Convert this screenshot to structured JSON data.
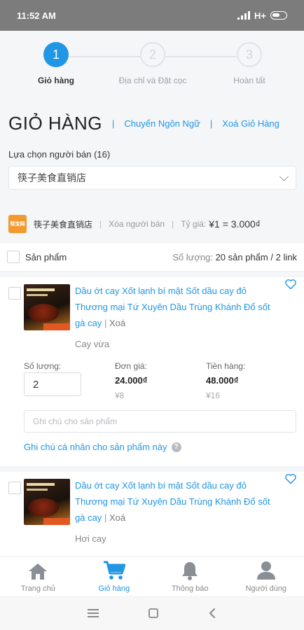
{
  "status": {
    "time": "11:52 AM",
    "network": "H+"
  },
  "stepper": {
    "steps": [
      {
        "num": "1",
        "label": "Giỏ hàng"
      },
      {
        "num": "2",
        "label": "Địa chỉ và Đặt cọc"
      },
      {
        "num": "3",
        "label": "Hoàn tất"
      }
    ]
  },
  "header": {
    "title": "GIỎ HÀNG",
    "change_lang": "Chuyển Ngôn Ngữ",
    "clear_cart": "Xoá Giỏ Hàng"
  },
  "seller_filter": {
    "label": "Lựa chọn người bán (16)",
    "selected": "筷子美食直销店"
  },
  "shop": {
    "logo_text": "筷宝网",
    "name": "筷子美食直销店",
    "remove": "Xóa người bán",
    "rate_label": "Tỷ giá:",
    "rate_value": "¥1 = 3.000₫"
  },
  "list_header": {
    "product": "Sản phẩm",
    "qty_label": "Số lượng:",
    "qty_value": "20 sản phẩm",
    "slash": "/",
    "links_value": "2",
    "links_label": "link"
  },
  "items": [
    {
      "name": "Dầu ớt cay Xốt lạnh bí mật Sốt dầu cay đỏ Thương mại Tứ Xuyên Dầu Trùng Khánh Đổ sốt gà cay",
      "delete": "Xoá",
      "variant": "Cay vừa",
      "qty_label": "Số lượng:",
      "qty": "2",
      "unit_label": "Đơn giá:",
      "unit_price": "24.000₫",
      "unit_price_cny": "¥8",
      "total_label": "Tiền hàng:",
      "total": "48.000₫",
      "total_cny": "¥16",
      "note_placeholder": "Ghi chú cho sản phẩm",
      "personal_note": "Ghi chú cá nhân cho sản phẩm này"
    },
    {
      "name": "Dầu ớt cay Xốt lạnh bí mật Sốt dầu cay đỏ Thương mại Tứ Xuyên Dầu Trùng Khánh Đổ sốt gà cay",
      "delete": "Xoá",
      "variant": "Hơi cay"
    }
  ],
  "nav": [
    {
      "label": "Trang chủ",
      "icon": "home-icon"
    },
    {
      "label": "Giỏ hàng",
      "icon": "cart-icon"
    },
    {
      "label": "Thông báo",
      "icon": "bell-icon"
    },
    {
      "label": "Người dùng",
      "icon": "user-icon"
    }
  ],
  "colors": {
    "accent": "#2096e5",
    "statusbar": "#7c7c7c",
    "shop_logo": "#f29a2e"
  }
}
